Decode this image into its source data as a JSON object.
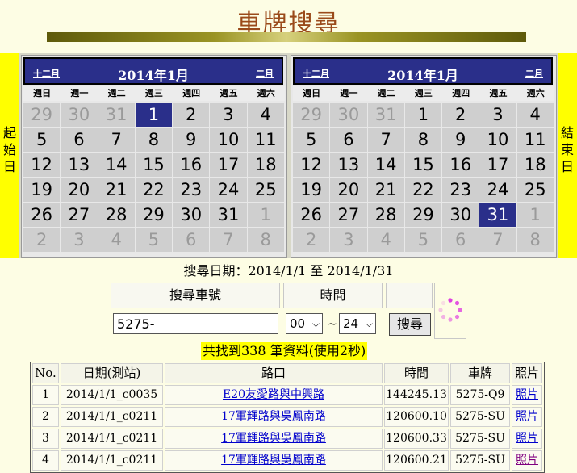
{
  "page": {
    "title": "車牌搜尋"
  },
  "calendar": {
    "start_label": "起始日",
    "end_label": "結束日",
    "weekdays": [
      "週日",
      "週一",
      "週二",
      "週三",
      "週四",
      "週五",
      "週六"
    ],
    "left": {
      "prev": "十二月",
      "next": "二月",
      "month": "2014年1月",
      "selected": 1,
      "days": [
        [
          "29",
          "o"
        ],
        [
          "30",
          "o"
        ],
        [
          "31",
          "o"
        ],
        [
          "1",
          "c"
        ],
        [
          "2",
          "c"
        ],
        [
          "3",
          "c"
        ],
        [
          "4",
          "c"
        ],
        [
          "5",
          "c"
        ],
        [
          "6",
          "c"
        ],
        [
          "7",
          "c"
        ],
        [
          "8",
          "c"
        ],
        [
          "9",
          "c"
        ],
        [
          "10",
          "c"
        ],
        [
          "11",
          "c"
        ],
        [
          "12",
          "c"
        ],
        [
          "13",
          "c"
        ],
        [
          "14",
          "c"
        ],
        [
          "15",
          "c"
        ],
        [
          "16",
          "c"
        ],
        [
          "17",
          "c"
        ],
        [
          "18",
          "c"
        ],
        [
          "19",
          "c"
        ],
        [
          "20",
          "c"
        ],
        [
          "21",
          "c"
        ],
        [
          "22",
          "c"
        ],
        [
          "23",
          "c"
        ],
        [
          "24",
          "c"
        ],
        [
          "25",
          "c"
        ],
        [
          "26",
          "c"
        ],
        [
          "27",
          "c"
        ],
        [
          "28",
          "c"
        ],
        [
          "29",
          "c"
        ],
        [
          "30",
          "c"
        ],
        [
          "31",
          "c"
        ],
        [
          "1",
          "o"
        ],
        [
          "2",
          "o"
        ],
        [
          "3",
          "o"
        ],
        [
          "4",
          "o"
        ],
        [
          "5",
          "o"
        ],
        [
          "6",
          "o"
        ],
        [
          "7",
          "o"
        ],
        [
          "8",
          "o"
        ]
      ]
    },
    "right": {
      "prev": "十二月",
      "next": "二月",
      "month": "2014年1月",
      "selected": 31,
      "days": [
        [
          "29",
          "o"
        ],
        [
          "30",
          "o"
        ],
        [
          "31",
          "o"
        ],
        [
          "1",
          "c"
        ],
        [
          "2",
          "c"
        ],
        [
          "3",
          "c"
        ],
        [
          "4",
          "c"
        ],
        [
          "5",
          "c"
        ],
        [
          "6",
          "c"
        ],
        [
          "7",
          "c"
        ],
        [
          "8",
          "c"
        ],
        [
          "9",
          "c"
        ],
        [
          "10",
          "c"
        ],
        [
          "11",
          "c"
        ],
        [
          "12",
          "c"
        ],
        [
          "13",
          "c"
        ],
        [
          "14",
          "c"
        ],
        [
          "15",
          "c"
        ],
        [
          "16",
          "c"
        ],
        [
          "17",
          "c"
        ],
        [
          "18",
          "c"
        ],
        [
          "19",
          "c"
        ],
        [
          "20",
          "c"
        ],
        [
          "21",
          "c"
        ],
        [
          "22",
          "c"
        ],
        [
          "23",
          "c"
        ],
        [
          "24",
          "c"
        ],
        [
          "25",
          "c"
        ],
        [
          "26",
          "c"
        ],
        [
          "27",
          "c"
        ],
        [
          "28",
          "c"
        ],
        [
          "29",
          "c"
        ],
        [
          "30",
          "c"
        ],
        [
          "31",
          "c"
        ],
        [
          "1",
          "o"
        ],
        [
          "2",
          "o"
        ],
        [
          "3",
          "o"
        ],
        [
          "4",
          "o"
        ],
        [
          "5",
          "o"
        ],
        [
          "6",
          "o"
        ],
        [
          "7",
          "o"
        ],
        [
          "8",
          "o"
        ]
      ]
    }
  },
  "search": {
    "range_text": "搜尋日期：2014/1/1 至 2014/1/31",
    "plate_header": "搜尋車號",
    "time_header": "時間",
    "plate_value": "5275-",
    "time_from": "00",
    "time_sep": "~",
    "time_to": "24",
    "button_label": "搜尋",
    "result_summary": "共找到338 筆資料(使用2秒)"
  },
  "results": {
    "columns": [
      "No.",
      "日期(測站)",
      "路口",
      "時間",
      "車牌",
      "照片"
    ],
    "rows": [
      [
        "1",
        "2014/1/1_c0035",
        "E20友愛路與中興路",
        "144245.13",
        "5275-Q9",
        "照片"
      ],
      [
        "2",
        "2014/1/1_c0211",
        "17軍輝路與吳鳳南路",
        "120600.10",
        "5275-SU",
        "照片"
      ],
      [
        "3",
        "2014/1/1_c0211",
        "17軍輝路與吳鳳南路",
        "120600.33",
        "5275-SU",
        "照片"
      ],
      [
        "4",
        "2014/1/1_c0211",
        "17軍輝路與吳鳳南路",
        "120600.21",
        "5275-SU",
        "照片"
      ]
    ]
  },
  "colors": {
    "accent": "#2a2f8a",
    "highlight": "#ffff00",
    "title": "#9a4a1a",
    "link": "#0000cc"
  }
}
